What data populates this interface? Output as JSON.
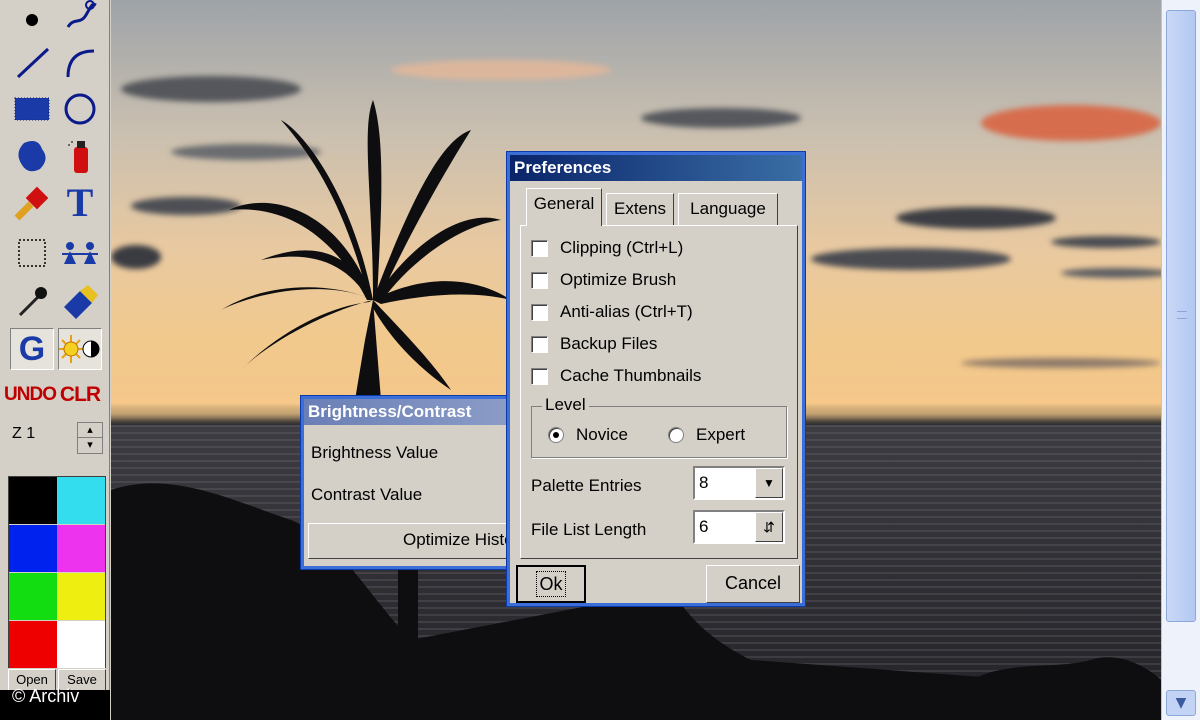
{
  "toolbar": {
    "tools": [
      "dot-tool",
      "freehand-tool",
      "line-tool",
      "arc-tool",
      "filled-rect-tool",
      "ellipse-tool",
      "fill-tool",
      "spray-tool",
      "brush-tool",
      "text-tool",
      "select-tool",
      "clone-tool",
      "eyedropper-tool",
      "eraser-tool",
      "gamma-tool",
      "brightness-contrast-tool",
      "undo-tool",
      "clear-tool"
    ],
    "text_tool_glyph": "T",
    "gamma_glyph": "G",
    "undo_label": "UNDO",
    "clear_label": "CLR",
    "zoom_label": "Z 1",
    "palette": [
      "#000000",
      "#33ddee",
      "#0022ee",
      "#ee33ee",
      "#11dd11",
      "#eeee11",
      "#ee0000",
      "#ffffff"
    ],
    "open_label": "Open",
    "save_label": "Save"
  },
  "watermark": "© Archiv",
  "brightness_dialog": {
    "title": "Brightness/Contrast",
    "brightness_label": "Brightness Value",
    "contrast_label": "Contrast Value",
    "optimize_label": "Optimize Histo"
  },
  "preferences": {
    "title": "Preferences",
    "tabs": [
      {
        "label": "General"
      },
      {
        "label": "Extens"
      },
      {
        "label": "Language"
      }
    ],
    "checkboxes": [
      {
        "label": "Clipping (Ctrl+L)"
      },
      {
        "label": "Optimize Brush"
      },
      {
        "label": "Anti-alias (Ctrl+T)"
      },
      {
        "label": "Backup Files"
      },
      {
        "label": "Cache Thumbnails"
      }
    ],
    "level_label": "Level",
    "level_options": [
      {
        "label": "Novice",
        "selected": true
      },
      {
        "label": "Expert",
        "selected": false
      }
    ],
    "palette_entries_label": "Palette Entries",
    "palette_entries_value": "8",
    "file_list_label": "File List Length",
    "file_list_value": "6",
    "ok_label": "Ok",
    "cancel_label": "Cancel"
  }
}
